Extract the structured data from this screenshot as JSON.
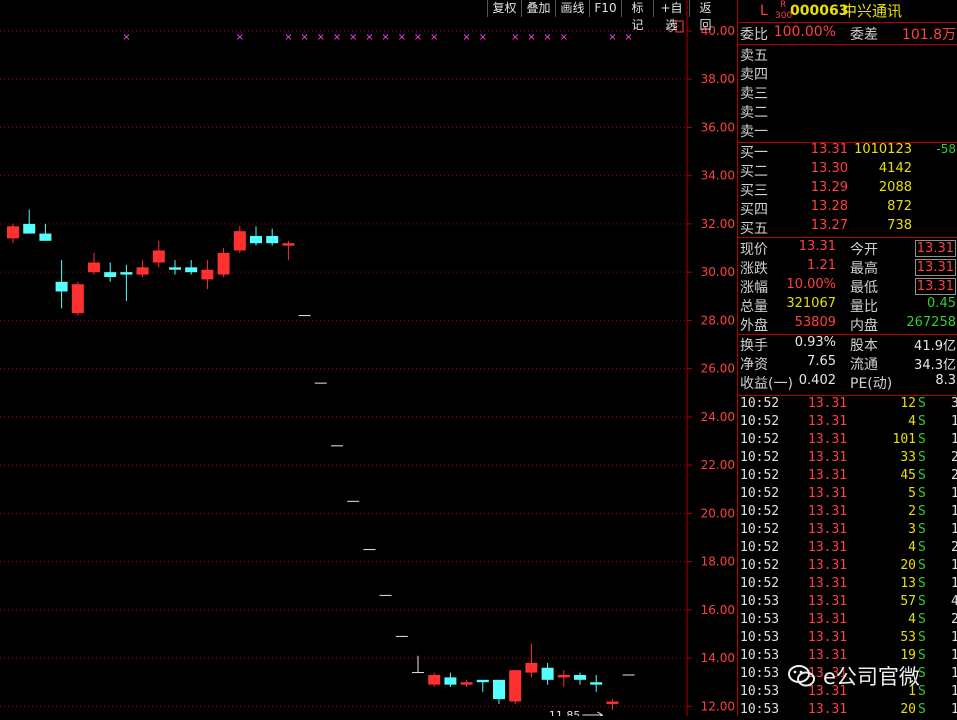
{
  "toolbar": [
    {
      "label": "复权"
    },
    {
      "label": "叠加"
    },
    {
      "label": "画线"
    },
    {
      "label": "F10"
    },
    {
      "label": "标记"
    },
    {
      "label": "+自选"
    },
    {
      "label": "返回"
    }
  ],
  "stock": {
    "prefix": "L",
    "sub_top": "R",
    "sub_bottom": "300",
    "code": "000063",
    "name": "中兴通讯"
  },
  "weibi": {
    "label1": "委比",
    "value1": "100.00%",
    "label2": "委差",
    "value2": "101.8万"
  },
  "sell_levels": [
    "卖五",
    "卖四",
    "卖三",
    "卖二",
    "卖一"
  ],
  "buy_levels": [
    {
      "label": "买一",
      "price": "13.31",
      "vol": "1010123",
      "chg": "-58"
    },
    {
      "label": "买二",
      "price": "13.30",
      "vol": "4142",
      "chg": ""
    },
    {
      "label": "买三",
      "price": "13.29",
      "vol": "2088",
      "chg": ""
    },
    {
      "label": "买四",
      "price": "13.28",
      "vol": "872",
      "chg": ""
    },
    {
      "label": "买五",
      "price": "13.27",
      "vol": "738",
      "chg": ""
    }
  ],
  "quote": [
    {
      "l1": "现价",
      "v1": "13.31",
      "c1": "red",
      "l2": "今开",
      "v2": "13.31",
      "c2": "red"
    },
    {
      "l1": "涨跌",
      "v1": "1.21",
      "c1": "red",
      "l2": "最高",
      "v2": "13.31",
      "c2": "red"
    },
    {
      "l1": "涨幅",
      "v1": "10.00%",
      "c1": "red",
      "l2": "最低",
      "v2": "13.31",
      "c2": "red"
    },
    {
      "l1": "总量",
      "v1": "321067",
      "c1": "yel",
      "l2": "量比",
      "v2": "0.45",
      "c2": "grn"
    },
    {
      "l1": "外盘",
      "v1": "53809",
      "c1": "red",
      "l2": "内盘",
      "v2": "267258",
      "c2": "grn"
    }
  ],
  "fundamentals": [
    {
      "l1": "换手",
      "v1": "0.93%",
      "l2": "股本",
      "v2": "41.9亿"
    },
    {
      "l1": "净资",
      "v1": "7.65",
      "l2": "流通",
      "v2": "34.3亿"
    },
    {
      "l1": "收益(一)",
      "v1": "0.402",
      "l2": "PE(动)",
      "v2": "8.3"
    }
  ],
  "ticks": [
    {
      "time": "10:52",
      "price": "13.31",
      "vol": "12",
      "side": "S",
      "extra": "3"
    },
    {
      "time": "10:52",
      "price": "13.31",
      "vol": "4",
      "side": "S",
      "extra": "1"
    },
    {
      "time": "10:52",
      "price": "13.31",
      "vol": "101",
      "side": "S",
      "extra": "1"
    },
    {
      "time": "10:52",
      "price": "13.31",
      "vol": "33",
      "side": "S",
      "extra": "2"
    },
    {
      "time": "10:52",
      "price": "13.31",
      "vol": "45",
      "side": "S",
      "extra": "2"
    },
    {
      "time": "10:52",
      "price": "13.31",
      "vol": "5",
      "side": "S",
      "extra": "1"
    },
    {
      "time": "10:52",
      "price": "13.31",
      "vol": "2",
      "side": "S",
      "extra": "1"
    },
    {
      "time": "10:52",
      "price": "13.31",
      "vol": "3",
      "side": "S",
      "extra": "1"
    },
    {
      "time": "10:52",
      "price": "13.31",
      "vol": "4",
      "side": "S",
      "extra": "2"
    },
    {
      "time": "10:52",
      "price": "13.31",
      "vol": "20",
      "side": "S",
      "extra": "1"
    },
    {
      "time": "10:52",
      "price": "13.31",
      "vol": "13",
      "side": "S",
      "extra": "1"
    },
    {
      "time": "10:53",
      "price": "13.31",
      "vol": "57",
      "side": "S",
      "extra": "4"
    },
    {
      "time": "10:53",
      "price": "13.31",
      "vol": "4",
      "side": "S",
      "extra": "2"
    },
    {
      "time": "10:53",
      "price": "13.31",
      "vol": "53",
      "side": "S",
      "extra": "1"
    },
    {
      "time": "10:53",
      "price": "13.31",
      "vol": "19",
      "side": "S",
      "extra": "1"
    },
    {
      "time": "10:53",
      "price": "13.31",
      "vol": "",
      "side": "S",
      "extra": "1"
    },
    {
      "time": "10:53",
      "price": "13.31",
      "vol": "1",
      "side": "S",
      "extra": "1"
    },
    {
      "time": "10:53",
      "price": "13.31",
      "vol": "20",
      "side": "S",
      "extra": "1"
    }
  ],
  "watermark": "e公司官微",
  "colors": {
    "up": "#ff3030",
    "down": "#54ffff",
    "grid": "#b00000",
    "marker": "#ff40ff"
  },
  "chart_data": {
    "type": "candlestick",
    "y_ticks": [
      "40.00",
      "38.00",
      "36.00",
      "34.00",
      "32.00",
      "30.00",
      "28.00",
      "26.00",
      "24.00",
      "22.00",
      "20.00",
      "18.00",
      "16.00",
      "14.00",
      "12.00"
    ],
    "ylim": [
      11.6,
      41.2
    ],
    "min_label": "11.85",
    "marker_glyph": "×",
    "markers_at": [
      7,
      14,
      17,
      18,
      19,
      20,
      21,
      22,
      23,
      24,
      25,
      26,
      28,
      29,
      31,
      32,
      33,
      34,
      37,
      38
    ],
    "candles": [
      {
        "o": 31.4,
        "h": 32.0,
        "l": 31.2,
        "c": 31.9
      },
      {
        "o": 32.0,
        "h": 32.6,
        "l": 31.6,
        "c": 31.6
      },
      {
        "o": 31.6,
        "h": 32.0,
        "l": 31.3,
        "c": 31.3
      },
      {
        "o": 29.6,
        "h": 30.5,
        "l": 28.5,
        "c": 29.2
      },
      {
        "o": 28.3,
        "h": 29.6,
        "l": 28.2,
        "c": 29.5
      },
      {
        "o": 30.0,
        "h": 30.8,
        "l": 29.9,
        "c": 30.4
      },
      {
        "o": 30.0,
        "h": 30.4,
        "l": 29.6,
        "c": 29.8
      },
      {
        "o": 30.0,
        "h": 30.3,
        "l": 28.8,
        "c": 29.9
      },
      {
        "o": 29.9,
        "h": 30.5,
        "l": 29.8,
        "c": 30.2
      },
      {
        "o": 30.4,
        "h": 31.3,
        "l": 30.2,
        "c": 30.9
      },
      {
        "o": 30.2,
        "h": 30.5,
        "l": 29.9,
        "c": 30.1
      },
      {
        "o": 30.2,
        "h": 30.5,
        "l": 29.9,
        "c": 30.0
      },
      {
        "o": 29.7,
        "h": 30.5,
        "l": 29.3,
        "c": 30.1
      },
      {
        "o": 29.9,
        "h": 31.0,
        "l": 29.8,
        "c": 30.8
      },
      {
        "o": 30.9,
        "h": 31.9,
        "l": 30.8,
        "c": 31.7
      },
      {
        "o": 31.5,
        "h": 31.9,
        "l": 31.1,
        "c": 31.2
      },
      {
        "o": 31.5,
        "h": 31.8,
        "l": 31.1,
        "c": 31.2
      },
      {
        "o": 31.1,
        "h": 31.3,
        "l": 30.5,
        "c": 31.2
      },
      {
        "o": 28.2,
        "h": 28.2,
        "l": 28.2,
        "c": 28.2
      },
      {
        "o": 25.4,
        "h": 25.4,
        "l": 25.4,
        "c": 25.4
      },
      {
        "o": 22.8,
        "h": 22.8,
        "l": 22.8,
        "c": 22.8
      },
      {
        "o": 20.5,
        "h": 20.5,
        "l": 20.5,
        "c": 20.5
      },
      {
        "o": 18.5,
        "h": 18.5,
        "l": 18.5,
        "c": 18.5
      },
      {
        "o": 16.6,
        "h": 16.6,
        "l": 16.6,
        "c": 16.6
      },
      {
        "o": 14.9,
        "h": 14.9,
        "l": 14.9,
        "c": 14.9
      },
      {
        "o": 13.4,
        "h": 14.1,
        "l": 13.4,
        "c": 13.4
      },
      {
        "o": 12.9,
        "h": 13.4,
        "l": 12.8,
        "c": 13.3
      },
      {
        "o": 13.2,
        "h": 13.4,
        "l": 12.8,
        "c": 12.9
      },
      {
        "o": 12.9,
        "h": 13.1,
        "l": 12.8,
        "c": 13.0
      },
      {
        "o": 13.1,
        "h": 13.1,
        "l": 12.6,
        "c": 13.0
      },
      {
        "o": 13.1,
        "h": 13.1,
        "l": 12.1,
        "c": 12.3
      },
      {
        "o": 12.2,
        "h": 13.5,
        "l": 12.1,
        "c": 13.5
      },
      {
        "o": 13.4,
        "h": 14.6,
        "l": 13.2,
        "c": 13.8
      },
      {
        "o": 13.6,
        "h": 13.8,
        "l": 12.9,
        "c": 13.1
      },
      {
        "o": 13.2,
        "h": 13.5,
        "l": 12.8,
        "c": 13.3
      },
      {
        "o": 13.3,
        "h": 13.4,
        "l": 12.9,
        "c": 13.1
      },
      {
        "o": 13.0,
        "h": 13.3,
        "l": 12.6,
        "c": 12.9
      },
      {
        "o": 12.1,
        "h": 12.3,
        "l": 11.85,
        "c": 12.2
      },
      {
        "o": 13.3,
        "h": 13.3,
        "l": 13.3,
        "c": 13.3
      }
    ]
  }
}
